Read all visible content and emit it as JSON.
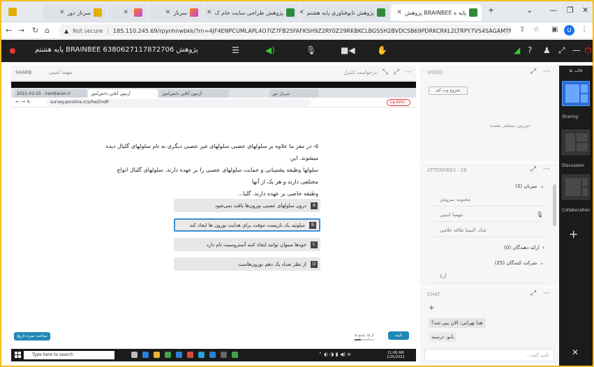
{
  "browser": {
    "tabs": [
      {
        "label": "پژوهش BRAINBEE پایه ه",
        "active": true
      },
      {
        "label": "پژوهش تابوفناوری پایه هشتم",
        "active": false
      },
      {
        "label": "پژوهش طراحی سایت خام ک",
        "active": false
      },
      {
        "label": "سرناز",
        "active": false
      },
      {
        "label": "",
        "active": false
      },
      {
        "label": "سرناز دور",
        "active": false
      }
    ],
    "not_secure": "Not secure",
    "url": "185.110.245.69/rpynhnwbkk/?rn=4JF4ENPCUMLAPL4O7IZ7FB25FAFKSH9Z2RY0Z29RKBKCLBGS5H2BVDCSB69PDRKCRKL2LTRPY7VS4SAGAMTMPM8...",
    "profile_initial": "U"
  },
  "appbar": {
    "title": "پایه هشتم BRAINBEE 6380627117872706 پژوهش"
  },
  "share": {
    "label": "SHARE",
    "presenter": "مهسا امینی",
    "request_control": "درخواست کنترل"
  },
  "inner": {
    "tabs": [
      {
        "label": "2021-01-25 - hamkaran.ir",
        "active": false
      },
      {
        "label": "آزمون آنلاین دانش‌آموز",
        "active": true
      },
      {
        "label": "آزمون آنلاین دانش‌آموز",
        "active": false
      },
      {
        "label": "سرناز دور",
        "active": false
      }
    ],
    "url": "survey.porsline.ir/s/hwZmdF",
    "update_btn": "Update :",
    "question": [
      "۵- در مغز ما علاوه بر سلولهای عصبی سلولهای غیر عصبی دیگری به نام سلولهای گلیال دیده",
      "میشوند. این",
      "سلولها وظیفه پشتیبانی و حمایت سلولهای عصبی را بر عهده دارند. سلولهای گلیال انواع",
      "مختلفی دارند و هر یک از آنها",
      "وظیفه خاصی بر عهده دارند. گلیا..."
    ],
    "options": [
      {
        "key": "A",
        "text": "درون سلولهای عصبی نورون‌ها یافت نمی‌شود",
        "selected": false
      },
      {
        "key": "B",
        "text": "میلوئید یک بازیست موقت برای هدایت نورون ها ایجاد کند",
        "selected": true
      },
      {
        "key": "C",
        "text": "خودها میتوان توانند ایجاد کنند آستروسیت نام دارد",
        "selected": false
      },
      {
        "key": "D",
        "text": "از نظر تعداد یک دهم نورون‌هاست",
        "selected": false
      }
    ],
    "left_button": "ساخت نمره تاریخ ارائی",
    "progress_label": "۵ از ۱۵ پاسخ داده شد",
    "progress": 0.33,
    "ok_button": "تایید",
    "taskbar_search": "Type here to search",
    "taskbar_time": "11:06 AM",
    "taskbar_date": "1/25/2021"
  },
  "video": {
    "title": "VIDEO",
    "share_camera": "شروع وب کم",
    "no_camera": "دوربین منتشر نشده"
  },
  "attendees": {
    "title": "ATTENDEES · 28",
    "hosts_group": "میزبان (3)",
    "hosts": [
      {
        "name": "محبوبه سروش",
        "mic": false
      },
      {
        "name": "مهسا امینی",
        "mic": true
      },
      {
        "name": "شاد. الیمیا طاقه غلامی",
        "mic": false
      }
    ],
    "presenters_group": "ارائه دهندگان (0)",
    "participants_group": "شرکت کنندگان (25)",
    "participants": [
      {
        "name": "آرتا"
      }
    ]
  },
  "chat": {
    "title": "CHAT",
    "messages": [
      {
        "text": "هدا تهرانی: الان ببی شد؟"
      },
      {
        "text": "بانو: درسته"
      }
    ],
    "placeholder": "تایپ کنید..."
  },
  "layouts": {
    "title": "قالب ها",
    "items": [
      {
        "label": "Sharing",
        "active": true
      },
      {
        "label": "Discussion",
        "active": false
      },
      {
        "label": "Collaboration",
        "active": false
      }
    ]
  },
  "colors": {
    "accent": "#1e88b8",
    "record": "#ee3333",
    "selected_border": "#3a8fd8",
    "layout_active": "#2f6bd6"
  }
}
